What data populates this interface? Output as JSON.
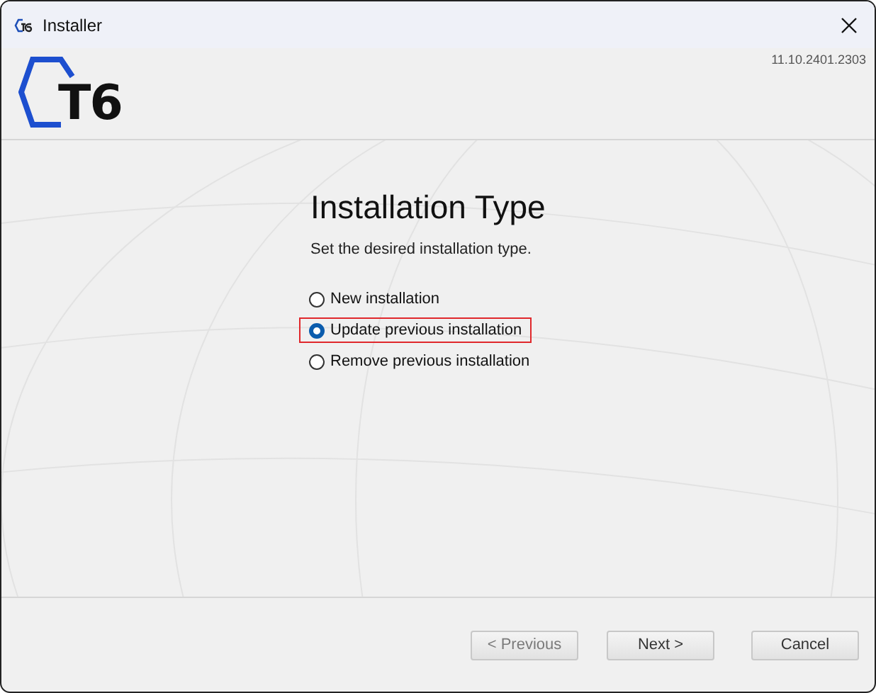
{
  "window": {
    "title": "Installer"
  },
  "header": {
    "logo_text": "T6",
    "version": "11.10.2401.2303"
  },
  "page": {
    "title": "Installation Type",
    "subtitle": "Set the desired installation type.",
    "options": [
      {
        "label": "New installation",
        "selected": false,
        "highlighted": false
      },
      {
        "label": "Update previous installation",
        "selected": true,
        "highlighted": true
      },
      {
        "label": "Remove previous installation",
        "selected": false,
        "highlighted": false
      }
    ]
  },
  "buttons": [
    {
      "label": "< Previous",
      "disabled": true
    },
    {
      "label": "Next >",
      "disabled": false
    },
    {
      "label": "Cancel",
      "disabled": false
    }
  ]
}
